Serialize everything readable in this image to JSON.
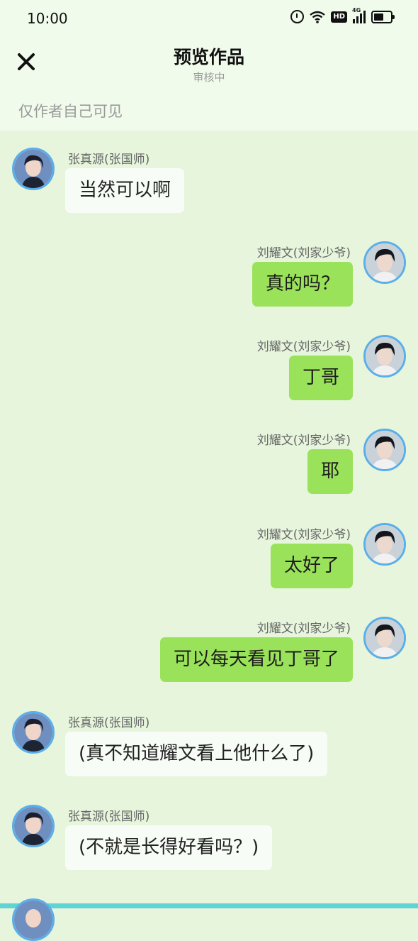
{
  "status": {
    "time": "10:00",
    "hd": "HD",
    "network": "4G"
  },
  "header": {
    "title": "预览作品",
    "subtitle": "审核中",
    "visibility": "仅作者自己可见",
    "close_icon": "close-icon"
  },
  "messages": [
    {
      "side": "left",
      "name": "张真源(张国师)",
      "text": "当然可以啊"
    },
    {
      "side": "right",
      "name": "刘耀文(刘家少爷)",
      "text": "真的吗？"
    },
    {
      "side": "right",
      "name": "刘耀文(刘家少爷)",
      "text": "丁哥"
    },
    {
      "side": "right",
      "name": "刘耀文(刘家少爷)",
      "text": "耶"
    },
    {
      "side": "right",
      "name": "刘耀文(刘家少爷)",
      "text": "太好了"
    },
    {
      "side": "right",
      "name": "刘耀文(刘家少爷)",
      "text": "可以每天看见丁哥了"
    },
    {
      "side": "left",
      "name": "张真源(张国师)",
      "text": "(真不知道耀文看上他什么了)"
    },
    {
      "side": "left",
      "name": "张真源(张国师)",
      "text": "(不就是长得好看吗？)"
    }
  ],
  "colors": {
    "background": "#e6f5dc",
    "header_bg": "#f1fbec",
    "own_bubble": "#9be25b",
    "other_bubble": "#f7fcf6",
    "avatar_ring": "#5aaee9"
  }
}
